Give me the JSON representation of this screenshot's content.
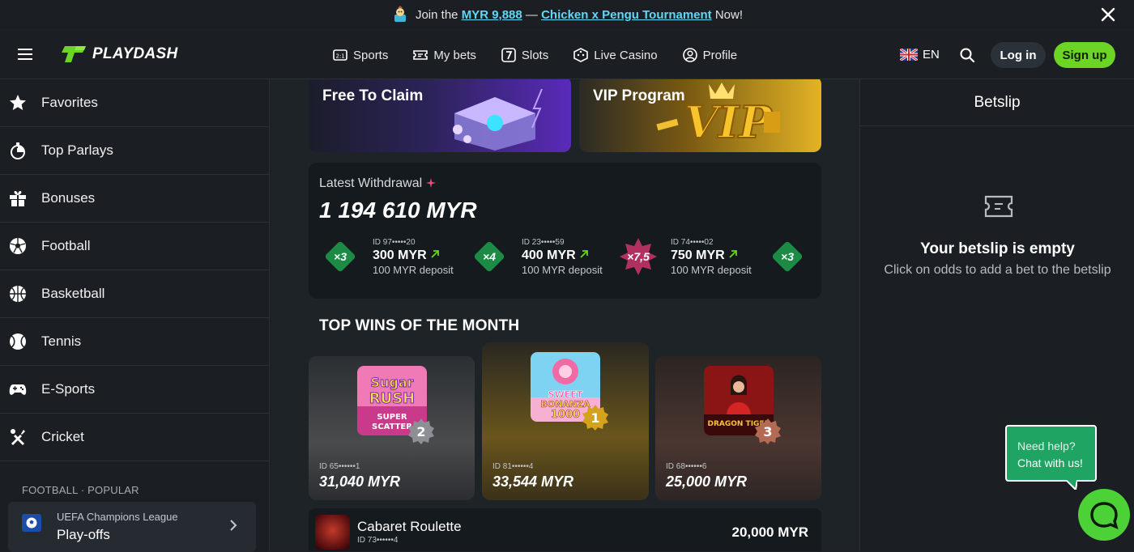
{
  "promo": {
    "prefix": "Join the",
    "amount_link": "MYR 9,888",
    "separator": "—",
    "tournament_link": "Chicken x Pengu Tournament",
    "suffix": "Now!"
  },
  "header": {
    "logo": "PLAYDASH",
    "nav": [
      {
        "label": "Sports",
        "icon": "sports-scoreboard-icon"
      },
      {
        "label": "My bets",
        "icon": "ticket-icon"
      },
      {
        "label": "Slots",
        "icon": "slot-seven-icon"
      },
      {
        "label": "Live Casino",
        "icon": "dice-icon"
      },
      {
        "label": "Profile",
        "icon": "user-circle-icon"
      }
    ],
    "language": "EN",
    "login_label": "Log in",
    "signup_label": "Sign up"
  },
  "sidebar": {
    "items": [
      {
        "label": "Favorites",
        "icon": "star-icon"
      },
      {
        "label": "Top Parlays",
        "icon": "stopwatch-icon"
      },
      {
        "label": "Bonuses",
        "icon": "gift-icon"
      },
      {
        "label": "Football",
        "icon": "football-icon"
      },
      {
        "label": "Basketball",
        "icon": "basketball-icon"
      },
      {
        "label": "Tennis",
        "icon": "tennis-ball-icon"
      },
      {
        "label": "E-Sports",
        "icon": "gamepad-icon"
      },
      {
        "label": "Cricket",
        "icon": "cricket-icon"
      }
    ],
    "section_label": "FOOTBALL · POPULAR",
    "league": {
      "name": "UEFA Champions League",
      "stage": "Play-offs"
    }
  },
  "banners": [
    {
      "title": "Free To Claim"
    },
    {
      "title": "VIP Program"
    }
  ],
  "withdrawal": {
    "label": "Latest Withdrawal",
    "amount": "1 194 610 MYR",
    "items": [
      {
        "multiplier": "×3",
        "id": "ID 97•••••20",
        "amount": "300 MYR",
        "deposit": "100 MYR deposit",
        "color": "#1d8a45"
      },
      {
        "multiplier": "×4",
        "id": "ID 23•••••59",
        "amount": "400 MYR",
        "deposit": "100 MYR deposit",
        "color": "#1d8a45"
      },
      {
        "multiplier": "×7,5",
        "id": "ID 74•••••02",
        "amount": "750 MYR",
        "deposit": "100 MYR deposit",
        "color": "#b0315f"
      },
      {
        "multiplier": "×3",
        "color": "#1d8a45"
      }
    ]
  },
  "top_wins": {
    "title": "TOP WINS OF THE MONTH",
    "cards": [
      {
        "rank": "2",
        "id": "ID 65••••••1",
        "amount": "31,040 MYR"
      },
      {
        "rank": "1",
        "id": "ID 81••••••4",
        "amount": "33,544 MYR"
      },
      {
        "rank": "3",
        "id": "ID 68••••••6",
        "amount": "25,000 MYR"
      }
    ]
  },
  "recent_win": {
    "game": "Cabaret Roulette",
    "id": "ID 73••••••4",
    "amount": "20,000 MYR"
  },
  "betslip": {
    "title": "Betslip",
    "empty_title": "Your betslip is empty",
    "empty_subtitle": "Click on odds to add a bet to the betslip"
  },
  "chat": {
    "question": "Need help?",
    "cta": "Chat with us!"
  },
  "colors": {
    "accent_green": "#6bd424",
    "link_cyan": "#62d7f5",
    "chat_green": "#1fa464"
  }
}
